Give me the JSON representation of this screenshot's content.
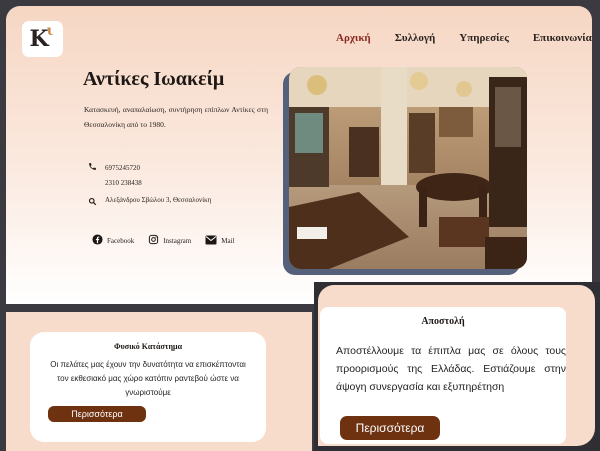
{
  "logo": {
    "letter": "K",
    "mark": "ι"
  },
  "nav": {
    "items": [
      {
        "label": "Αρχική",
        "active": true
      },
      {
        "label": "Συλλογή",
        "active": false
      },
      {
        "label": "Υπηρεσίες",
        "active": false
      },
      {
        "label": "Επικοινωνία",
        "active": false
      }
    ]
  },
  "hero": {
    "title": "Αντίκες Ιωακείμ",
    "description": "Κατασκευή, αναπαλαίωση, συντήρηση επίπλων Αντίκες στη Θεσσαλονίκη από το 1980."
  },
  "contact": {
    "phone_icon": "phone-icon",
    "phones": [
      "6975245720",
      "2310 238438"
    ],
    "address_icon": "search-icon",
    "address": "Αλεξάνδρου Σβώλου 3, Θεσσαλονίκη"
  },
  "social": [
    {
      "icon": "facebook-icon",
      "label": "Facebook"
    },
    {
      "icon": "instagram-icon",
      "label": "Instagram"
    },
    {
      "icon": "mail-icon",
      "label": "Mail"
    }
  ],
  "cards": {
    "store": {
      "title": "Φυσικό Κατάστημα",
      "text": "Οι πελάτες μας έχουν την δυνατότητα να επισκέπτονται τον εκθεσιακό μας χώρο κατόπιν ραντεβού ώστε να γνωριστούμε",
      "button": "Περισσότερα"
    },
    "shipping": {
      "title": "Αποστολή",
      "text": "Αποστέλλουμε τα έπιπλα μας σε όλους τους προορισμούς της Ελλάδας. Εστιάζουμε στην άψογη συνεργασία και εξυπηρέτηση",
      "button": "Περισσότερα"
    }
  },
  "colors": {
    "accent": "#6e3211",
    "active_nav": "#8c2a22",
    "background": "#f8dccb"
  }
}
